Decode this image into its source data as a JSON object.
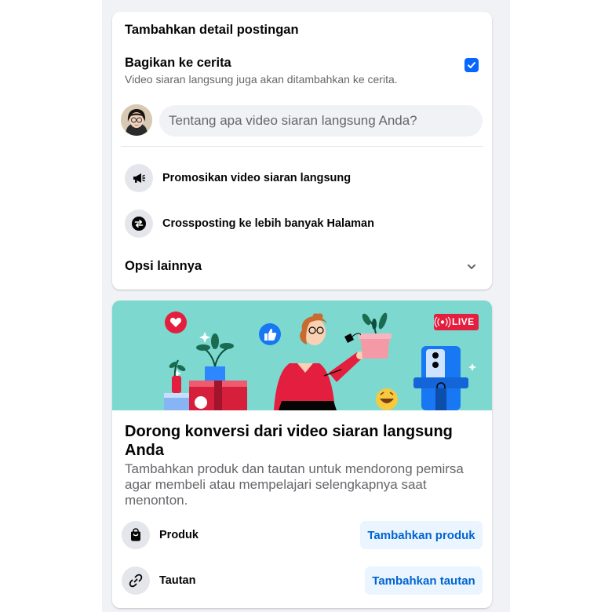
{
  "post_details": {
    "section_title": "Tambahkan detail postingan",
    "story_title": "Bagikan ke cerita",
    "story_subtitle": "Video siaran langsung juga akan ditambahkan ke cerita.",
    "story_checked": true,
    "composer_placeholder": "Tentang apa video siaran langsung Anda?",
    "options": [
      {
        "icon": "megaphone-icon",
        "label": "Promosikan video siaran langsung"
      },
      {
        "icon": "crosspost-icon",
        "label": "Crossposting ke lebih banyak Halaman"
      }
    ],
    "more_options": "Opsi lainnya"
  },
  "conversion": {
    "live_badge": "LIVE",
    "title": "Dorong konversi dari video siaran langsung Anda",
    "description": "Tambahkan produk dan tautan untuk mendorong pemirsa agar membeli atau mempelajari selengkapnya saat menonton.",
    "rows": [
      {
        "icon": "shopping-bag-icon",
        "label": "Produk",
        "button": "Tambahkan produk"
      },
      {
        "icon": "link-icon",
        "label": "Tautan",
        "button": "Tambahkan tautan"
      }
    ]
  },
  "colors": {
    "accent": "#0866ff",
    "button_bg": "#ebf5ff",
    "button_text": "#0064d1",
    "banner_bg": "#7dd9cf"
  }
}
